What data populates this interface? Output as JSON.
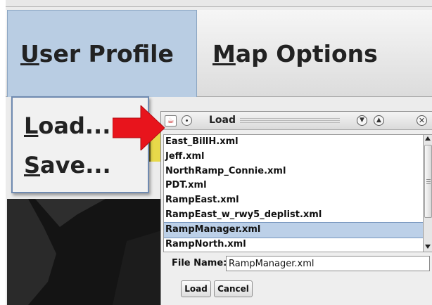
{
  "menubar": {
    "user_profile": {
      "mnemonic": "U",
      "rest": "ser Profile"
    },
    "map_options": {
      "mnemonic": "M",
      "rest": "ap Options"
    }
  },
  "dropdown": {
    "load": {
      "mnemonic": "L",
      "rest": "oad..."
    },
    "save": {
      "mnemonic": "S",
      "rest": "ave..."
    }
  },
  "dialog": {
    "title": "Load",
    "files": [
      "East_BillH.xml",
      "Jeff.xml",
      "NorthRamp_Connie.xml",
      "PDT.xml",
      "RampEast.xml",
      "RampEast_w_rwy5_deplist.xml",
      "RampManager.xml",
      "RampNorth.xml"
    ],
    "selected_file": "RampManager.xml",
    "file_name_label": "File Name:",
    "file_name_value": "RampManager.xml",
    "load_button": "Load",
    "cancel_button": "Cancel"
  },
  "icons": {
    "app_icon": "java-cup-icon",
    "window_menu": "circle-dot-icon",
    "minimize": "chevron-down-icon",
    "maximize": "chevron-up-icon",
    "close": "close-icon",
    "annotation": "red-arrow-icon"
  },
  "colors": {
    "selection": "#bcd0e8",
    "arrow": "#e8141c",
    "menu_active": "#b9cde3"
  }
}
